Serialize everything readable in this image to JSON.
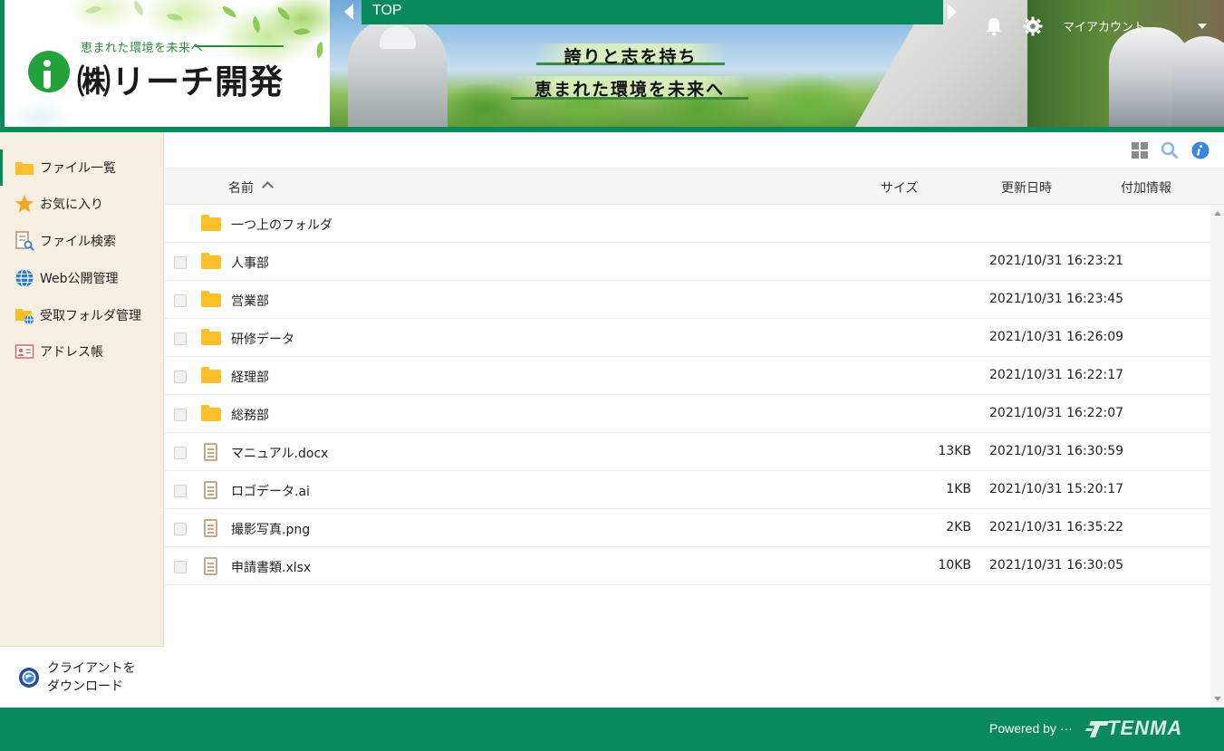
{
  "brand": {
    "tagline": "恵まれた環境を未来へ",
    "company": "㈱リーチ開発"
  },
  "banner": {
    "slogan_line1": "誇りと志を持ち",
    "slogan_line2": "恵まれた環境を未来へ"
  },
  "header": {
    "nav_label": "TOP",
    "account_label": "マイアカウント",
    "accent_color": "#0a8a5a"
  },
  "sidebar": {
    "items": [
      {
        "label": "ファイル一覧",
        "icon": "folder-icon",
        "active": true
      },
      {
        "label": "お気に入り",
        "icon": "star-icon"
      },
      {
        "label": "ファイル検索",
        "icon": "file-search-icon"
      },
      {
        "label": "Web公開管理",
        "icon": "globe-icon"
      },
      {
        "label": "受取フォルダ管理",
        "icon": "receive-folder-icon"
      },
      {
        "label": "アドレス帳",
        "icon": "address-book-icon"
      }
    ],
    "client_download": {
      "line1": "クライアントを",
      "line2": "ダウンロード"
    }
  },
  "toolbar": {
    "icons": [
      "grid-view-icon",
      "search-icon",
      "info-icon"
    ]
  },
  "table": {
    "columns": {
      "name": "名前",
      "size": "サイズ",
      "modified": "更新日時",
      "extra": "付加情報"
    },
    "parent_folder": "一つ上のフォルダ",
    "rows": [
      {
        "type": "folder",
        "name": "人事部",
        "size": "",
        "modified": "2021/10/31 16:23:21"
      },
      {
        "type": "folder",
        "name": "営業部",
        "size": "",
        "modified": "2021/10/31 16:23:45"
      },
      {
        "type": "folder",
        "name": "研修データ",
        "size": "",
        "modified": "2021/10/31 16:26:09"
      },
      {
        "type": "folder",
        "name": "経理部",
        "size": "",
        "modified": "2021/10/31 16:22:17"
      },
      {
        "type": "folder",
        "name": "総務部",
        "size": "",
        "modified": "2021/10/31 16:22:07"
      },
      {
        "type": "file",
        "name": "マニュアル.docx",
        "size": "13KB",
        "modified": "2021/10/31 16:30:59"
      },
      {
        "type": "file",
        "name": "ロゴデータ.ai",
        "size": "1KB",
        "modified": "2021/10/31 15:20:17"
      },
      {
        "type": "file",
        "name": "撮影写真.png",
        "size": "2KB",
        "modified": "2021/10/31 16:35:22"
      },
      {
        "type": "file",
        "name": "申請書類.xlsx",
        "size": "10KB",
        "modified": "2021/10/31 16:30:05"
      }
    ]
  },
  "footer": {
    "powered_by": "Powered by ···",
    "vendor": "TENMA"
  }
}
